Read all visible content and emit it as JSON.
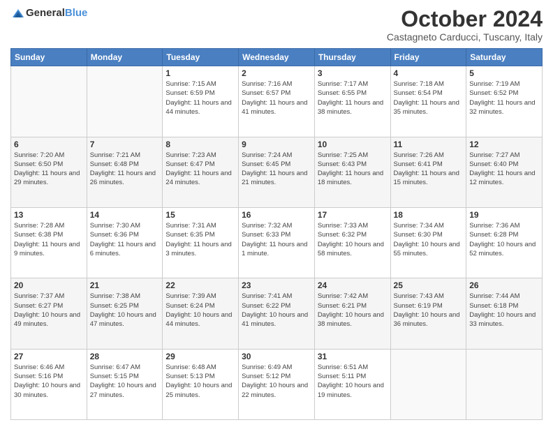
{
  "header": {
    "logo": {
      "text_general": "General",
      "text_blue": "Blue"
    },
    "month": "October 2024",
    "location": "Castagneto Carducci, Tuscany, Italy"
  },
  "days_of_week": [
    "Sunday",
    "Monday",
    "Tuesday",
    "Wednesday",
    "Thursday",
    "Friday",
    "Saturday"
  ],
  "weeks": [
    [
      {
        "day": "",
        "sunrise": "",
        "sunset": "",
        "daylight": "",
        "empty": true
      },
      {
        "day": "",
        "sunrise": "",
        "sunset": "",
        "daylight": "",
        "empty": true
      },
      {
        "day": "1",
        "sunrise": "Sunrise: 7:15 AM",
        "sunset": "Sunset: 6:59 PM",
        "daylight": "Daylight: 11 hours and 44 minutes.",
        "empty": false
      },
      {
        "day": "2",
        "sunrise": "Sunrise: 7:16 AM",
        "sunset": "Sunset: 6:57 PM",
        "daylight": "Daylight: 11 hours and 41 minutes.",
        "empty": false
      },
      {
        "day": "3",
        "sunrise": "Sunrise: 7:17 AM",
        "sunset": "Sunset: 6:55 PM",
        "daylight": "Daylight: 11 hours and 38 minutes.",
        "empty": false
      },
      {
        "day": "4",
        "sunrise": "Sunrise: 7:18 AM",
        "sunset": "Sunset: 6:54 PM",
        "daylight": "Daylight: 11 hours and 35 minutes.",
        "empty": false
      },
      {
        "day": "5",
        "sunrise": "Sunrise: 7:19 AM",
        "sunset": "Sunset: 6:52 PM",
        "daylight": "Daylight: 11 hours and 32 minutes.",
        "empty": false
      }
    ],
    [
      {
        "day": "6",
        "sunrise": "Sunrise: 7:20 AM",
        "sunset": "Sunset: 6:50 PM",
        "daylight": "Daylight: 11 hours and 29 minutes.",
        "empty": false
      },
      {
        "day": "7",
        "sunrise": "Sunrise: 7:21 AM",
        "sunset": "Sunset: 6:48 PM",
        "daylight": "Daylight: 11 hours and 26 minutes.",
        "empty": false
      },
      {
        "day": "8",
        "sunrise": "Sunrise: 7:23 AM",
        "sunset": "Sunset: 6:47 PM",
        "daylight": "Daylight: 11 hours and 24 minutes.",
        "empty": false
      },
      {
        "day": "9",
        "sunrise": "Sunrise: 7:24 AM",
        "sunset": "Sunset: 6:45 PM",
        "daylight": "Daylight: 11 hours and 21 minutes.",
        "empty": false
      },
      {
        "day": "10",
        "sunrise": "Sunrise: 7:25 AM",
        "sunset": "Sunset: 6:43 PM",
        "daylight": "Daylight: 11 hours and 18 minutes.",
        "empty": false
      },
      {
        "day": "11",
        "sunrise": "Sunrise: 7:26 AM",
        "sunset": "Sunset: 6:41 PM",
        "daylight": "Daylight: 11 hours and 15 minutes.",
        "empty": false
      },
      {
        "day": "12",
        "sunrise": "Sunrise: 7:27 AM",
        "sunset": "Sunset: 6:40 PM",
        "daylight": "Daylight: 11 hours and 12 minutes.",
        "empty": false
      }
    ],
    [
      {
        "day": "13",
        "sunrise": "Sunrise: 7:28 AM",
        "sunset": "Sunset: 6:38 PM",
        "daylight": "Daylight: 11 hours and 9 minutes.",
        "empty": false
      },
      {
        "day": "14",
        "sunrise": "Sunrise: 7:30 AM",
        "sunset": "Sunset: 6:36 PM",
        "daylight": "Daylight: 11 hours and 6 minutes.",
        "empty": false
      },
      {
        "day": "15",
        "sunrise": "Sunrise: 7:31 AM",
        "sunset": "Sunset: 6:35 PM",
        "daylight": "Daylight: 11 hours and 3 minutes.",
        "empty": false
      },
      {
        "day": "16",
        "sunrise": "Sunrise: 7:32 AM",
        "sunset": "Sunset: 6:33 PM",
        "daylight": "Daylight: 11 hours and 1 minute.",
        "empty": false
      },
      {
        "day": "17",
        "sunrise": "Sunrise: 7:33 AM",
        "sunset": "Sunset: 6:32 PM",
        "daylight": "Daylight: 10 hours and 58 minutes.",
        "empty": false
      },
      {
        "day": "18",
        "sunrise": "Sunrise: 7:34 AM",
        "sunset": "Sunset: 6:30 PM",
        "daylight": "Daylight: 10 hours and 55 minutes.",
        "empty": false
      },
      {
        "day": "19",
        "sunrise": "Sunrise: 7:36 AM",
        "sunset": "Sunset: 6:28 PM",
        "daylight": "Daylight: 10 hours and 52 minutes.",
        "empty": false
      }
    ],
    [
      {
        "day": "20",
        "sunrise": "Sunrise: 7:37 AM",
        "sunset": "Sunset: 6:27 PM",
        "daylight": "Daylight: 10 hours and 49 minutes.",
        "empty": false
      },
      {
        "day": "21",
        "sunrise": "Sunrise: 7:38 AM",
        "sunset": "Sunset: 6:25 PM",
        "daylight": "Daylight: 10 hours and 47 minutes.",
        "empty": false
      },
      {
        "day": "22",
        "sunrise": "Sunrise: 7:39 AM",
        "sunset": "Sunset: 6:24 PM",
        "daylight": "Daylight: 10 hours and 44 minutes.",
        "empty": false
      },
      {
        "day": "23",
        "sunrise": "Sunrise: 7:41 AM",
        "sunset": "Sunset: 6:22 PM",
        "daylight": "Daylight: 10 hours and 41 minutes.",
        "empty": false
      },
      {
        "day": "24",
        "sunrise": "Sunrise: 7:42 AM",
        "sunset": "Sunset: 6:21 PM",
        "daylight": "Daylight: 10 hours and 38 minutes.",
        "empty": false
      },
      {
        "day": "25",
        "sunrise": "Sunrise: 7:43 AM",
        "sunset": "Sunset: 6:19 PM",
        "daylight": "Daylight: 10 hours and 36 minutes.",
        "empty": false
      },
      {
        "day": "26",
        "sunrise": "Sunrise: 7:44 AM",
        "sunset": "Sunset: 6:18 PM",
        "daylight": "Daylight: 10 hours and 33 minutes.",
        "empty": false
      }
    ],
    [
      {
        "day": "27",
        "sunrise": "Sunrise: 6:46 AM",
        "sunset": "Sunset: 5:16 PM",
        "daylight": "Daylight: 10 hours and 30 minutes.",
        "empty": false
      },
      {
        "day": "28",
        "sunrise": "Sunrise: 6:47 AM",
        "sunset": "Sunset: 5:15 PM",
        "daylight": "Daylight: 10 hours and 27 minutes.",
        "empty": false
      },
      {
        "day": "29",
        "sunrise": "Sunrise: 6:48 AM",
        "sunset": "Sunset: 5:13 PM",
        "daylight": "Daylight: 10 hours and 25 minutes.",
        "empty": false
      },
      {
        "day": "30",
        "sunrise": "Sunrise: 6:49 AM",
        "sunset": "Sunset: 5:12 PM",
        "daylight": "Daylight: 10 hours and 22 minutes.",
        "empty": false
      },
      {
        "day": "31",
        "sunrise": "Sunrise: 6:51 AM",
        "sunset": "Sunset: 5:11 PM",
        "daylight": "Daylight: 10 hours and 19 minutes.",
        "empty": false
      },
      {
        "day": "",
        "sunrise": "",
        "sunset": "",
        "daylight": "",
        "empty": true
      },
      {
        "day": "",
        "sunrise": "",
        "sunset": "",
        "daylight": "",
        "empty": true
      }
    ]
  ]
}
